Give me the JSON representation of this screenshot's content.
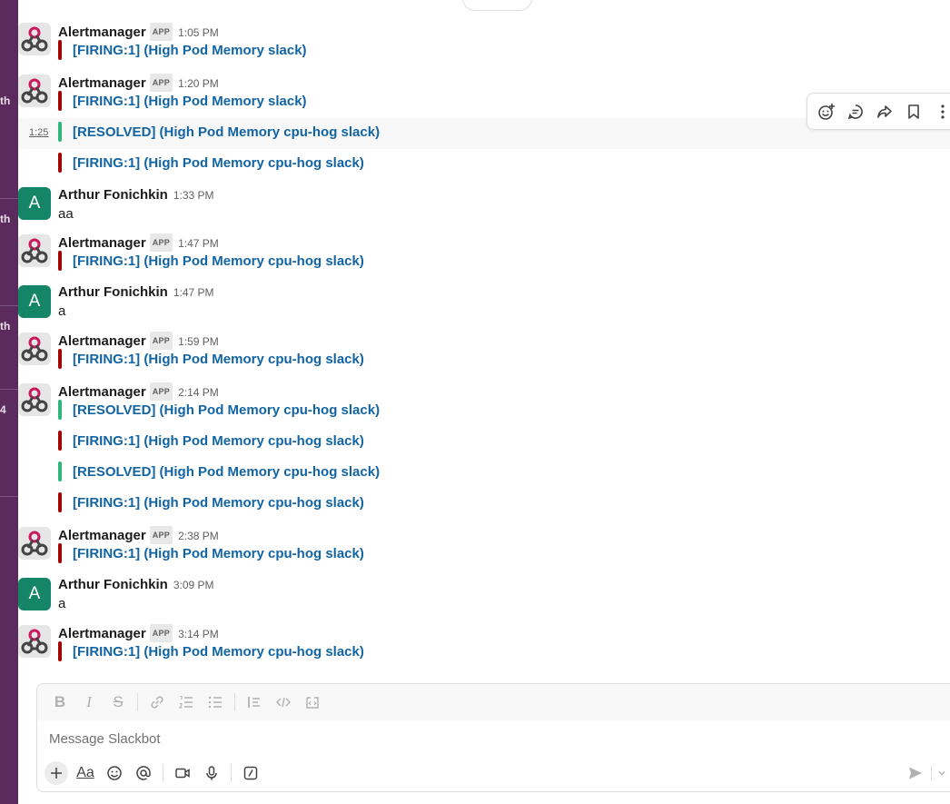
{
  "sidebar_fragments": [
    "th",
    "th",
    "th",
    "4"
  ],
  "app_badge": "APP",
  "messages": [
    {
      "sender": "Alertmanager",
      "time": "1:05 PM",
      "attachments": [
        {
          "status": "firing",
          "text": "[FIRING:1]  (High Pod Memory slack)"
        }
      ]
    },
    {
      "sender": "Alertmanager",
      "time": "1:20 PM",
      "attachments": [
        {
          "status": "firing",
          "text": "[FIRING:1]  (High Pod Memory slack)"
        }
      ]
    },
    {
      "hover_time": "1:25",
      "attachments": [
        {
          "status": "resolved",
          "text": "[RESOLVED]  (High Pod Memory cpu-hog slack)"
        }
      ]
    },
    {
      "attachments": [
        {
          "status": "firing",
          "text": "[FIRING:1]  (High Pod Memory cpu-hog slack)"
        }
      ]
    },
    {
      "sender": "Arthur Fonichkin",
      "initial": "A",
      "time": "1:33 PM",
      "text": "aa"
    },
    {
      "sender": "Alertmanager",
      "time": "1:47 PM",
      "attachments": [
        {
          "status": "firing",
          "text": "[FIRING:1]  (High Pod Memory cpu-hog slack)"
        }
      ]
    },
    {
      "sender": "Arthur Fonichkin",
      "initial": "A",
      "time": "1:47 PM",
      "text": "a"
    },
    {
      "sender": "Alertmanager",
      "time": "1:59 PM",
      "attachments": [
        {
          "status": "firing",
          "text": "[FIRING:1]  (High Pod Memory cpu-hog slack)"
        }
      ]
    },
    {
      "sender": "Alertmanager",
      "time": "2:14 PM",
      "attachments": [
        {
          "status": "resolved",
          "text": "[RESOLVED]  (High Pod Memory cpu-hog slack)"
        },
        {
          "status": "firing",
          "text": "[FIRING:1]  (High Pod Memory cpu-hog slack)"
        },
        {
          "status": "resolved",
          "text": "[RESOLVED]  (High Pod Memory cpu-hog slack)"
        },
        {
          "status": "firing",
          "text": "[FIRING:1]  (High Pod Memory cpu-hog slack)"
        }
      ]
    },
    {
      "sender": "Alertmanager",
      "time": "2:38 PM",
      "attachments": [
        {
          "status": "firing",
          "text": "[FIRING:1]  (High Pod Memory cpu-hog slack)"
        }
      ]
    },
    {
      "sender": "Arthur Fonichkin",
      "initial": "A",
      "time": "3:09 PM",
      "text": "a"
    },
    {
      "sender": "Alertmanager",
      "time": "3:14 PM",
      "attachments": [
        {
          "status": "firing",
          "text": "[FIRING:1]  (High Pod Memory cpu-hog slack)"
        }
      ]
    }
  ],
  "hover_toolbar": {
    "icons": [
      "add-reaction-icon",
      "reply-in-thread-icon",
      "forward-icon",
      "bookmark-icon",
      "more-actions-icon"
    ]
  },
  "composer": {
    "placeholder": "Message Slackbot",
    "format_icons": [
      "bold-icon",
      "italic-icon",
      "strikethrough-icon",
      "link-icon",
      "ordered-list-icon",
      "bulleted-list-icon",
      "blockquote-icon",
      "code-icon",
      "code-block-icon"
    ],
    "bottom_icons": [
      "plus-icon",
      "formatting-icon",
      "emoji-icon",
      "mention-icon",
      "video-icon",
      "microphone-icon",
      "shortcuts-icon"
    ],
    "formatting_label": "Aa"
  },
  "colors": {
    "firing": "#a30200",
    "resolved": "#2eb67d",
    "link": "#1264a3",
    "user_avatar": "#148567",
    "sidebar": "#5a2b5c"
  }
}
